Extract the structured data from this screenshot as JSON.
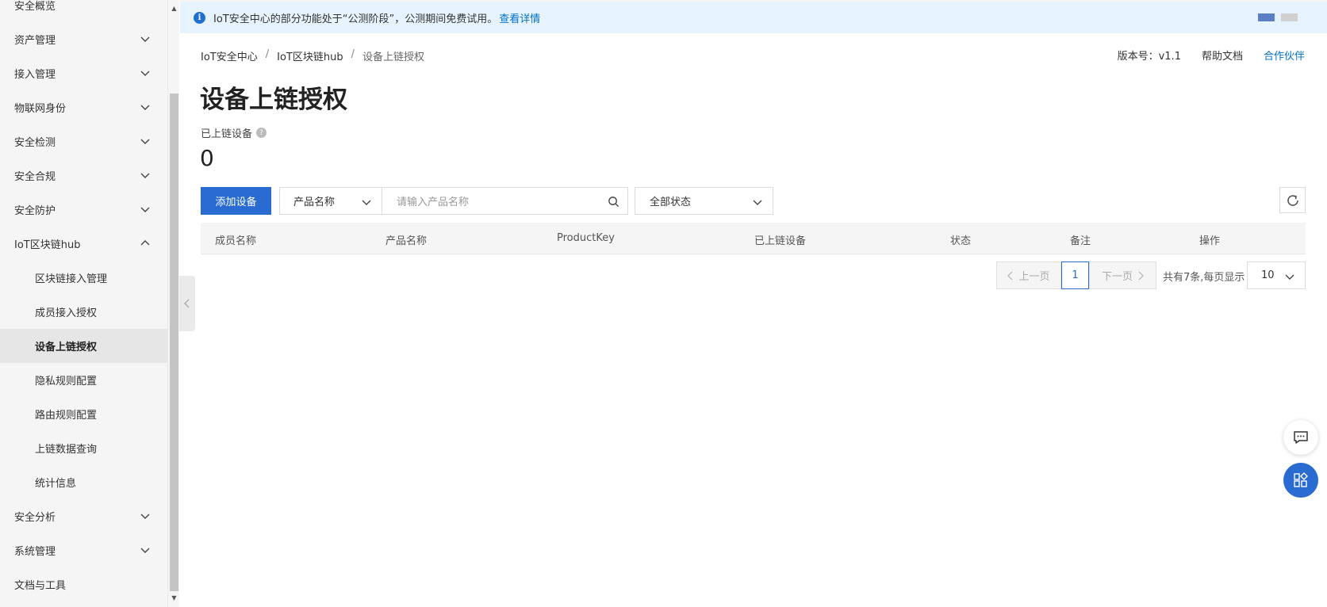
{
  "sidebar": {
    "items": [
      {
        "label": "安全概览",
        "expandable": false
      },
      {
        "label": "资产管理",
        "expandable": true
      },
      {
        "label": "接入管理",
        "expandable": true
      },
      {
        "label": "物联网身份",
        "expandable": true
      },
      {
        "label": "安全检测",
        "expandable": true
      },
      {
        "label": "安全合规",
        "expandable": true
      },
      {
        "label": "安全防护",
        "expandable": true
      },
      {
        "label": "IoT区块链hub",
        "expandable": true,
        "expanded": true
      },
      {
        "label": "区块链接入管理",
        "sub": true
      },
      {
        "label": "成员接入授权",
        "sub": true
      },
      {
        "label": "设备上链授权",
        "sub": true,
        "active": true
      },
      {
        "label": "隐私规则配置",
        "sub": true
      },
      {
        "label": "路由规则配置",
        "sub": true
      },
      {
        "label": "上链数据查询",
        "sub": true
      },
      {
        "label": "统计信息",
        "sub": true
      },
      {
        "label": "安全分析",
        "expandable": true
      },
      {
        "label": "系统管理",
        "expandable": true
      },
      {
        "label": "文档与工具",
        "expandable": false
      }
    ]
  },
  "notice": {
    "text": "IoT安全中心的部分功能处于“公测阶段”，公测期间免费试用。",
    "link": "查看详情"
  },
  "breadcrumb": {
    "items": [
      "IoT安全中心",
      "IoT区块链hub",
      "设备上链授权"
    ],
    "separator": "/"
  },
  "header_links": {
    "version": "版本号：v1.1",
    "help": "帮助文档",
    "partner": "合作伙伴"
  },
  "page": {
    "title": "设备上链授权",
    "stat_label": "已上链设备",
    "stat_value": "0"
  },
  "toolbar": {
    "add_label": "添加设备",
    "product_select": "产品名称",
    "search_placeholder": "请输入产品名称",
    "status_select": "全部状态"
  },
  "table": {
    "columns": [
      "成员名称",
      "产品名称",
      "ProductKey",
      "已上链设备",
      "状态",
      "备注",
      "操作"
    ]
  },
  "pagination": {
    "prev": "上一页",
    "current": "1",
    "next": "下一页",
    "total_text": "共有7条,每页显示",
    "page_size": "10"
  },
  "colors": {
    "primary": "#2a6bd2",
    "link": "#0070cc",
    "notice_bg": "#e6f3fc",
    "sidebar_bg": "#f5f5f5"
  }
}
